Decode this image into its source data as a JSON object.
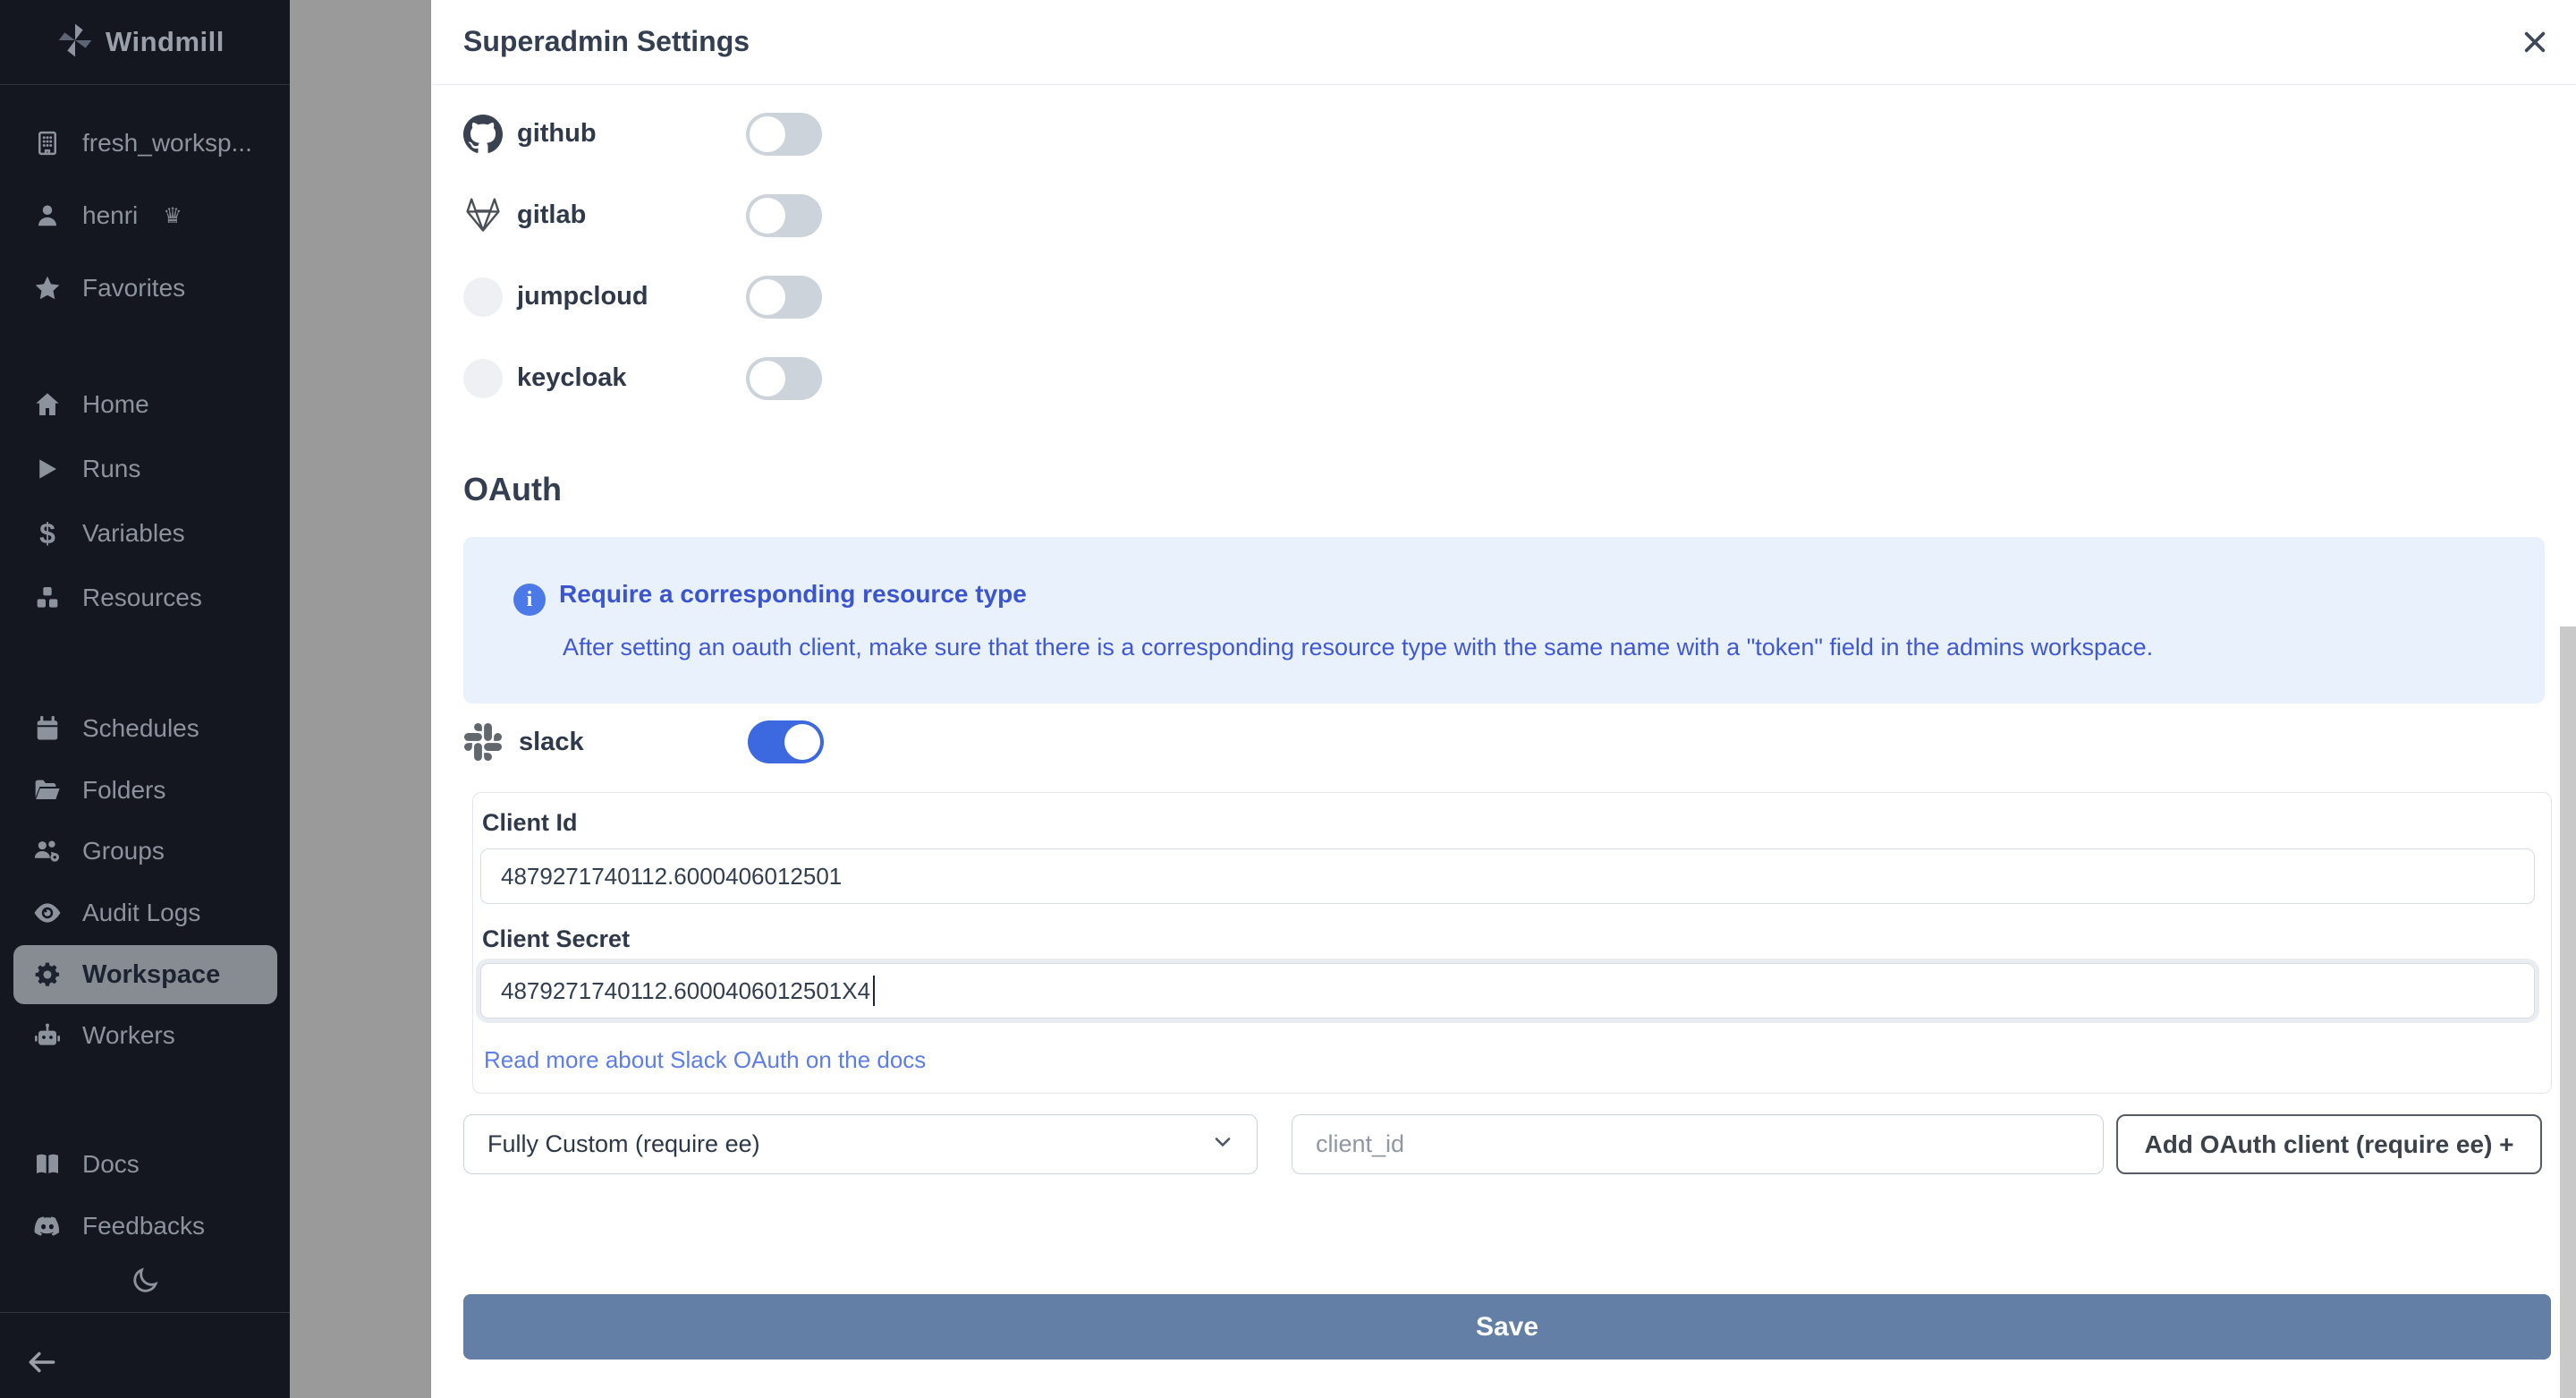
{
  "sidebar": {
    "logo": "Windmill",
    "workspace": {
      "label": "fresh_worksp...",
      "icon": "building-icon"
    },
    "user": {
      "label": "henri",
      "badge": "superadmin-crown",
      "icon": "user-icon"
    },
    "favorites": {
      "label": "Favorites",
      "icon": "star-icon"
    },
    "nav": [
      {
        "label": "Home",
        "icon": "home-icon"
      },
      {
        "label": "Runs",
        "icon": "play-icon"
      },
      {
        "label": "Variables",
        "icon": "dollar-icon"
      },
      {
        "label": "Resources",
        "icon": "cubes-icon"
      }
    ],
    "nav2": [
      {
        "label": "Schedules",
        "icon": "calendar-icon"
      },
      {
        "label": "Folders",
        "icon": "folder-icon"
      },
      {
        "label": "Groups",
        "icon": "users-icon"
      },
      {
        "label": "Audit Logs",
        "icon": "eye-icon"
      },
      {
        "label": "Workspace",
        "icon": "gear-icon",
        "active": true
      },
      {
        "label": "Workers",
        "icon": "robot-icon"
      }
    ],
    "footer": [
      {
        "label": "Docs",
        "icon": "book-icon"
      },
      {
        "label": "Feedbacks",
        "icon": "discord-icon"
      }
    ],
    "theme_toggle_icon": "moon-icon",
    "collapse_icon": "arrow-left-icon"
  },
  "modal": {
    "title": "Superadmin Settings",
    "close_icon": "close-icon",
    "providers": [
      {
        "name": "github",
        "icon": "github-icon",
        "enabled": false
      },
      {
        "name": "gitlab",
        "icon": "gitlab-icon",
        "enabled": false
      },
      {
        "name": "jumpcloud",
        "icon": "blank-circle",
        "enabled": false
      },
      {
        "name": "keycloak",
        "icon": "blank-circle",
        "enabled": false
      }
    ],
    "oauth": {
      "heading": "OAuth",
      "info_title": "Require a corresponding resource type",
      "info_body": "After setting an oauth client, make sure that there is a corresponding resource type with the same name with a \"token\" field in the admins workspace.",
      "slack": {
        "name": "slack",
        "icon": "slack-icon",
        "enabled": true,
        "client_id_label": "Client Id",
        "client_id_value": "4879271740112.6000406012501",
        "client_secret_label": "Client Secret",
        "client_secret_value": "4879271740112.6000406012501X4",
        "docs_link": "Read more about Slack OAuth on the docs"
      },
      "custom_client": {
        "select_value": "Fully Custom (require ee)",
        "input_placeholder": "client_id",
        "add_button_label": "Add OAuth client (require ee) +"
      }
    },
    "save_label": "Save"
  },
  "colors": {
    "accent_blue": "#3c69e0",
    "info_bg": "#e8f1fc",
    "info_text": "#3b55d1",
    "link_blue": "#5d7de9",
    "save_button": "#647fa5",
    "sidebar_bg": "#14171f",
    "backdrop": "#9a9a9a"
  }
}
